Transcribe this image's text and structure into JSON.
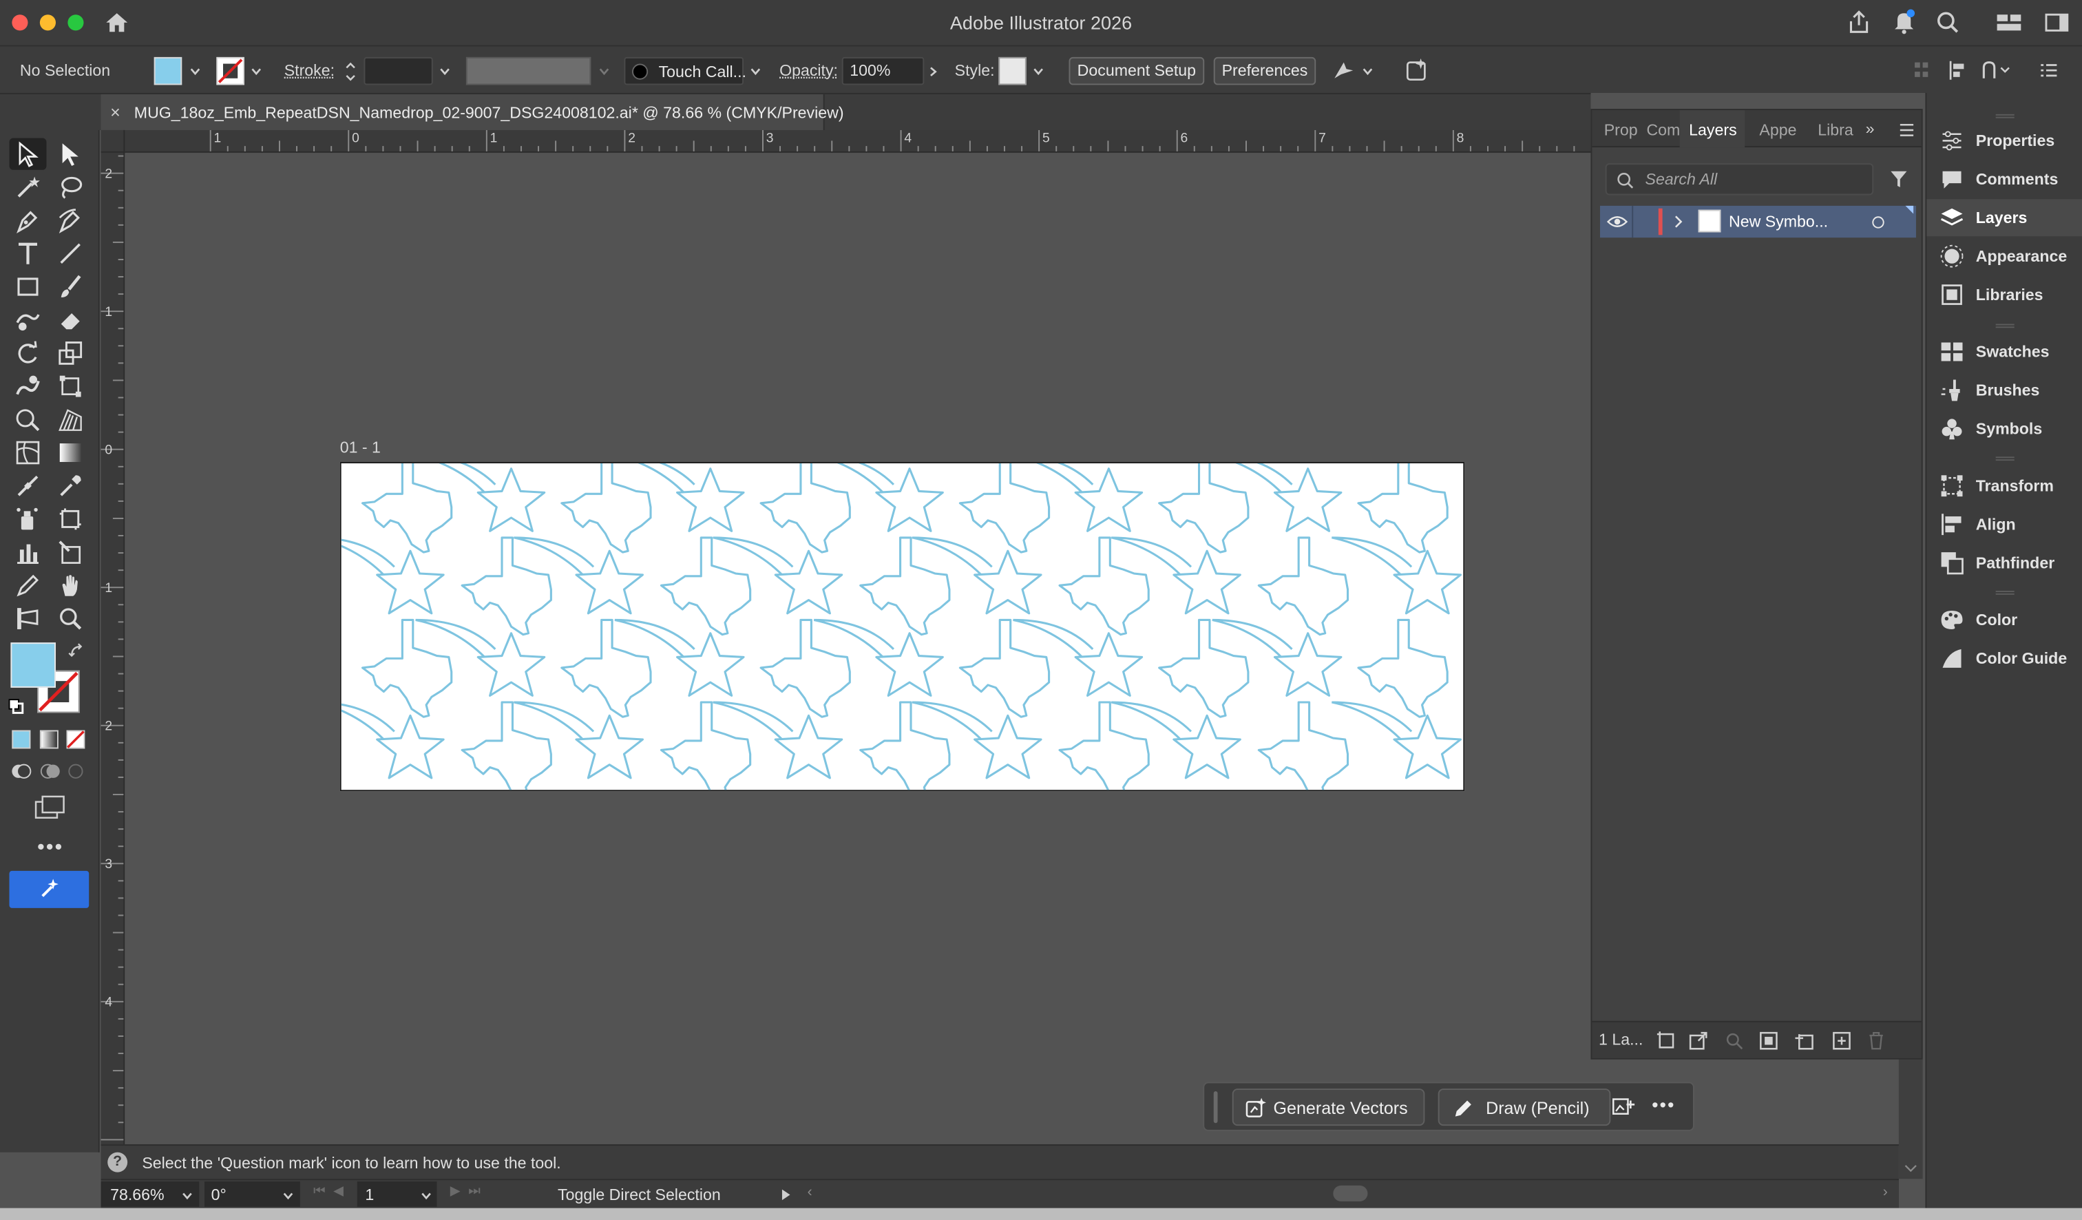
{
  "app": {
    "title": "Adobe Illustrator 2026"
  },
  "control_bar": {
    "selection": "No Selection",
    "stroke_label": "Stroke:",
    "brush_name": "Touch Call...",
    "opacity_label": "Opacity:",
    "opacity_value": "100%",
    "style_label": "Style:",
    "document_setup": "Document Setup",
    "preferences": "Preferences"
  },
  "document": {
    "tab_title": "MUG_18oz_Emb_RepeatDSN_Namedrop_02-9007_DSG24008102.ai* @ 78.66 % (CMYK/Preview)",
    "artboard_label": "01 - 1"
  },
  "rulers": {
    "horizontal": [
      "0",
      "1",
      "2",
      "3",
      "4",
      "5",
      "6",
      "7",
      "8"
    ],
    "horizontal_neg": "1",
    "vertical": [
      "2",
      "1",
      "0",
      "1",
      "2",
      "3",
      "4"
    ]
  },
  "layers_panel": {
    "tabs": [
      "Prop",
      "Com",
      "Layers",
      "Appe",
      "Libra"
    ],
    "active_tab": "Layers",
    "search_placeholder": "Search All",
    "layers": [
      {
        "name": "New Symbo..."
      }
    ],
    "footer_count": "1 La..."
  },
  "dock": {
    "group1": [
      "Properties",
      "Comments",
      "Layers",
      "Appearance",
      "Libraries"
    ],
    "group2": [
      "Swatches",
      "Brushes",
      "Symbols"
    ],
    "group3": [
      "Transform",
      "Align",
      "Pathfinder"
    ],
    "group4": [
      "Color",
      "Color Guide"
    ]
  },
  "task_bar": {
    "generate_vectors": "Generate Vectors",
    "draw_pencil": "Draw (Pencil)"
  },
  "hint": "Select the 'Question mark' icon to learn how to use the tool.",
  "status": {
    "zoom": "78.66%",
    "rotation": "0°",
    "artboard_number": "1",
    "tool_name": "Toggle Direct Selection"
  },
  "colors": {
    "fill": "#87ceeb",
    "pattern_stroke": "#7ec4e0",
    "accent_blue": "#2d6fe0",
    "selected_layer": "#4e5f7e",
    "layer_color_bar": "#e05050"
  }
}
